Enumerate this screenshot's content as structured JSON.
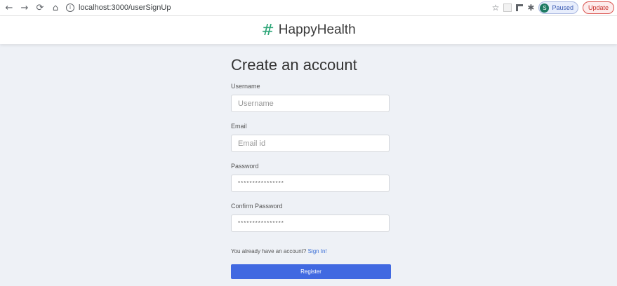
{
  "browser": {
    "url": "localhost:3000/userSignUp",
    "profile_initial": "S",
    "profile_status": "Paused",
    "update_label": "Update"
  },
  "header": {
    "brand": "HappyHealth"
  },
  "form": {
    "title": "Create an account",
    "username_label": "Username",
    "username_placeholder": "Username",
    "email_label": "Email",
    "email_placeholder": "Email id",
    "password_label": "Password",
    "password_value": "****************",
    "confirm_label": "Confirm Password",
    "confirm_value": "****************",
    "signin_prompt": "You already have an account?",
    "signin_link": "Sign In!",
    "register_label": "Register"
  }
}
